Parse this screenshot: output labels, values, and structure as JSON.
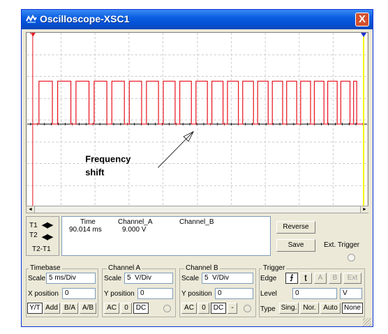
{
  "window": {
    "title": "Oscilloscope-XSC1",
    "close_glyph": "X"
  },
  "screen": {
    "background": "#ffffff",
    "grid_color": "#c8c8c8",
    "trace_color": "#e8101b",
    "cursor1_color": "#e8101b",
    "cursor2_color": "#1f2fd0",
    "yellow_edge": "#f5f500",
    "annotation": [
      "Frequency",
      "shift"
    ]
  },
  "readout": {
    "time_header": "Time",
    "cha_header": "Channel_A",
    "chb_header": "Channel_B",
    "t1_label": "T1",
    "t2_label": "T2",
    "t2t1_label": "T2-T1",
    "time_value": "90.014 ms",
    "cha_value": "9.000 V"
  },
  "buttons": {
    "reverse": "Reverse",
    "save": "Save",
    "ext_trigger": "Ext. Trigger"
  },
  "timebase": {
    "title": "Timebase",
    "scale_label": "Scale",
    "scale_value": "5 ms/Div",
    "xpos_label": "X position",
    "xpos_value": "0",
    "modes": [
      "Y/T",
      "Add",
      "B/A",
      "A/B"
    ]
  },
  "channel_a": {
    "title": "Channel A",
    "scale_label": "Scale",
    "scale_value": "5  V/Div",
    "ypos_label": "Y position",
    "ypos_value": "0",
    "coupling": [
      "AC",
      "0",
      "DC"
    ]
  },
  "channel_b": {
    "title": "Channel B",
    "scale_label": "Scale",
    "scale_value": "5  V/Div",
    "ypos_label": "Y position",
    "ypos_value": "0",
    "coupling": [
      "AC",
      "0",
      "DC",
      "-"
    ]
  },
  "trigger": {
    "title": "Trigger",
    "edge_label": "Edge",
    "edge_buttons": [
      "A",
      "B",
      "Ext"
    ],
    "level_label": "Level",
    "level_value": "0",
    "level_unit": "V",
    "type_label": "Type",
    "types": [
      "Sing.",
      "Nor.",
      "Auto",
      "None"
    ]
  }
}
